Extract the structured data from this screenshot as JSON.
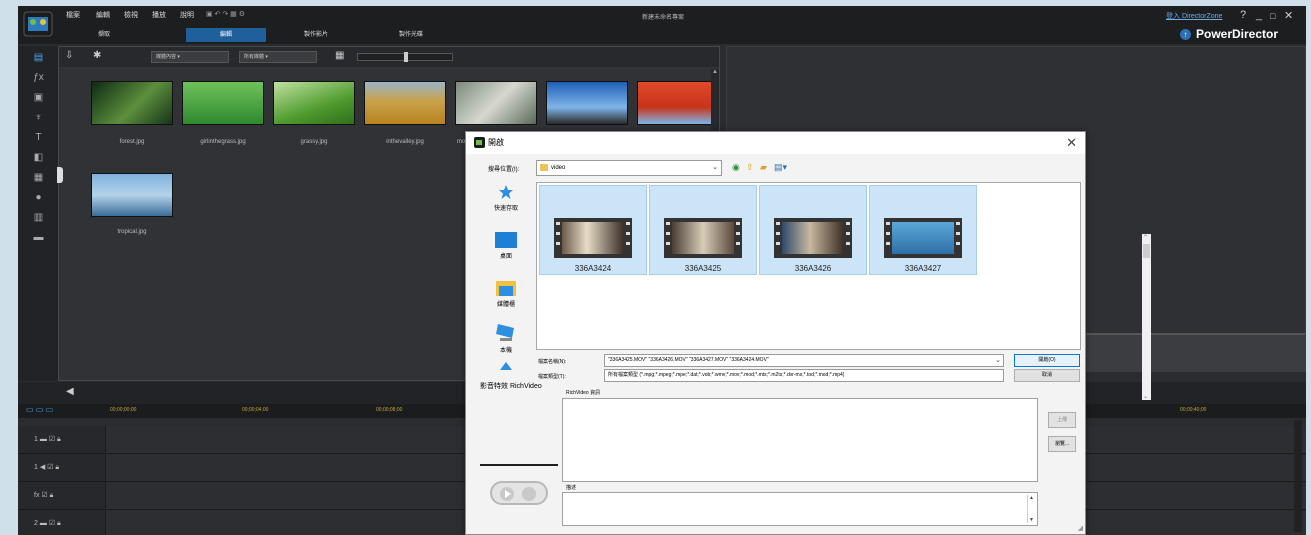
{
  "app": {
    "title": "新建未命名專案",
    "menus": [
      "檔案",
      "編輯",
      "檢視",
      "播放",
      "說明"
    ],
    "mode_tabs": [
      "擷取",
      "編輯",
      "製作影片",
      "製作光碟"
    ],
    "active_mode": "編輯",
    "user_link": "登入 DirectorZone",
    "brand": "PowerDirector",
    "window_buttons": [
      "?",
      "_",
      "□",
      "✕"
    ]
  },
  "library": {
    "dropdowns": [
      "媒體內容",
      "所有媒體"
    ],
    "items": [
      {
        "label": "forest.jpg"
      },
      {
        "label": "girlinthegrass.jpg"
      },
      {
        "label": "grassy.jpg"
      },
      {
        "label": "inthevalley.jpg"
      },
      {
        "label": "mo"
      },
      {
        "label": ""
      },
      {
        "label": ""
      },
      {
        "label": "tropical.jpg"
      }
    ]
  },
  "timeline": {
    "ticks": [
      "00;00;00;00",
      "00;00;04;00",
      "00;00;08;00",
      "00;00;40;00"
    ],
    "tracks": [
      "1",
      "1",
      "fx",
      "2"
    ]
  },
  "dialog": {
    "title": "開啟",
    "lookin_label": "搜尋位置(I):",
    "lookin_value": "video",
    "places": [
      "快速存取",
      "桌面",
      "媒體櫃",
      "本機",
      "網路"
    ],
    "files": [
      {
        "name": "336A3424"
      },
      {
        "name": "336A3425"
      },
      {
        "name": "336A3426"
      },
      {
        "name": "336A3427"
      }
    ],
    "filename_label": "檔案名稱(N):",
    "filename_value": "\"336A3425.MOV\" \"336A3426.MOV\" \"336A3427.MOV\" \"336A3424.MOV\"",
    "filetype_label": "檔案類型(T):",
    "filetype_value": "所有檔案類型 (*.mpg;*.mpeg;*.mpe;*.dat;*.vob;*.wmv;*.mov;*.mod;*.mts;*.m2ts;*.dvr-ms;*.tod;*.mod;*.mp4)",
    "open_label": "開啟(O)",
    "cancel_label": "取消",
    "richvideo_title": "影音特效 RichVideo",
    "richvideo_box_label": "RichVideo 資訊",
    "description_label": "描述",
    "side_buttons": [
      "上傳",
      "瀏覽..."
    ]
  },
  "colors": {
    "selection": "#cce4f7",
    "brand_blue": "#2d6fb0",
    "timecode": "#c8a23a"
  }
}
